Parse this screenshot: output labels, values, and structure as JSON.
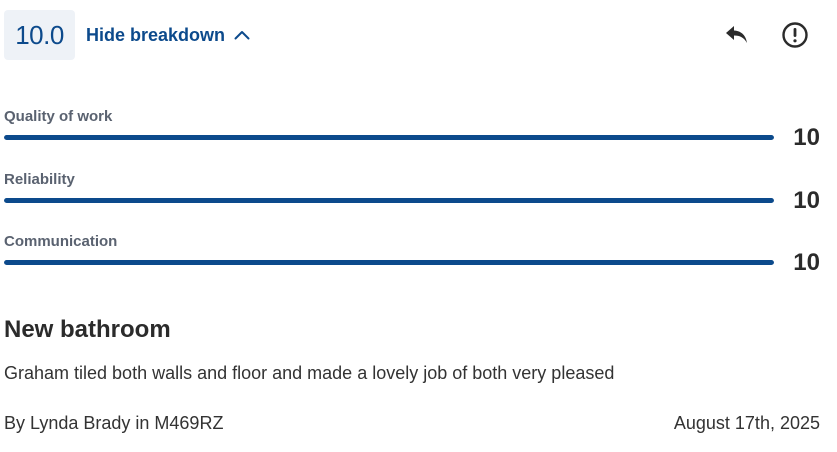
{
  "score": {
    "overall": "10.0"
  },
  "breakdown_toggle": {
    "label": "Hide breakdown",
    "icon": "chevron-up-icon"
  },
  "actions": {
    "reply_icon": "reply-icon",
    "report_icon": "alert-circle-icon"
  },
  "ratings": [
    {
      "label": "Quality of work",
      "value": "10",
      "fraction": 1.0
    },
    {
      "label": "Reliability",
      "value": "10",
      "fraction": 1.0
    },
    {
      "label": "Communication",
      "value": "10",
      "fraction": 1.0
    }
  ],
  "review": {
    "title": "New bathroom",
    "body": "Graham tiled both walls and floor and made a lovely job of both very pleased",
    "author_line": "By Lynda Brady in M469RZ",
    "date": "August 17th, 2025"
  },
  "colors": {
    "accent": "#0c4a8c",
    "badge_background": "#eef2f7",
    "track": "#d9dee6",
    "label_gray": "#5a6270"
  }
}
